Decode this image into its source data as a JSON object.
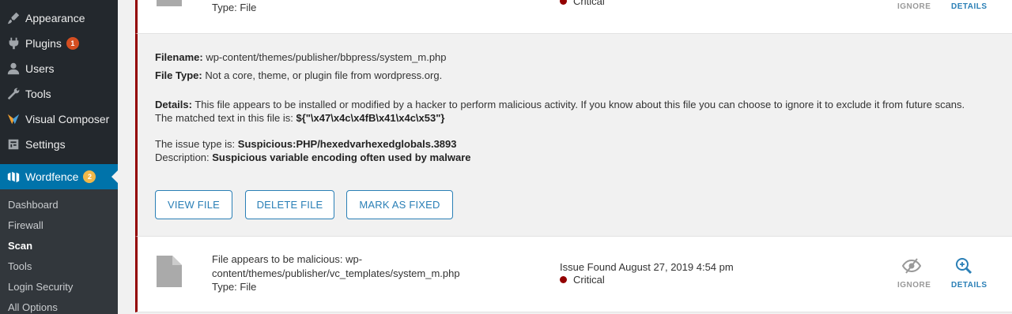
{
  "sidebar": {
    "items": [
      {
        "label": "Appearance",
        "icon": "paintbrush-icon"
      },
      {
        "label": "Plugins",
        "icon": "plugin-icon",
        "badge": "1"
      },
      {
        "label": "Users",
        "icon": "user-icon"
      },
      {
        "label": "Tools",
        "icon": "wrench-icon"
      },
      {
        "label": "Visual Composer",
        "icon": "visual-composer-icon"
      },
      {
        "label": "Settings",
        "icon": "settings-icon"
      },
      {
        "label": "Wordfence",
        "icon": "wordfence-icon",
        "badge": "2"
      }
    ],
    "submenu": [
      "Dashboard",
      "Firewall",
      "Scan",
      "Tools",
      "Login Security",
      "All Options"
    ],
    "current_submenu": "Scan"
  },
  "issue_top": {
    "type": "Type: File",
    "severity": "Critical",
    "ignore_label": "IGNORE",
    "details_label": "DETAILS"
  },
  "detail": {
    "filename_label": "Filename:",
    "filename": "wp-content/themes/publisher/bbpress/system_m.php",
    "filetype_label": "File Type:",
    "filetype": "Not a core, theme, or plugin file from wordpress.org.",
    "details_label": "Details:",
    "details_text": "This file appears to be installed or modified by a hacker to perform malicious activity. If you know about this file you can choose to ignore it to exclude it from future scans.",
    "matched_prefix": "The matched text in this file is:",
    "matched_text": "${\"\\x47\\x4c\\x4fB\\x41\\x4c\\x53\"}",
    "issue_type_prefix": "The issue type is:",
    "issue_type": "Suspicious:PHP/hexedvarhexedglobals.3893",
    "description_prefix": "Description:",
    "description": "Suspicious variable encoding often used by malware",
    "buttons": {
      "view": "VIEW FILE",
      "delete": "DELETE FILE",
      "fixed": "MARK AS FIXED"
    }
  },
  "issue_bottom": {
    "title_line1": "File appears to be malicious: wp-",
    "title_line2": "content/themes/publisher/vc_templates/system_m.php",
    "type": "Type: File",
    "found": "Issue Found August 27, 2019 4:54 pm",
    "severity": "Critical",
    "ignore_label": "IGNORE",
    "details_label": "DETAILS"
  },
  "colors": {
    "sidebar_bg": "#23282d",
    "submenu_bg": "#32373c",
    "active_menu": "#0073aa",
    "critical": "#930000",
    "link_blue": "#2a7fb6",
    "matched_red": "#e00000"
  }
}
